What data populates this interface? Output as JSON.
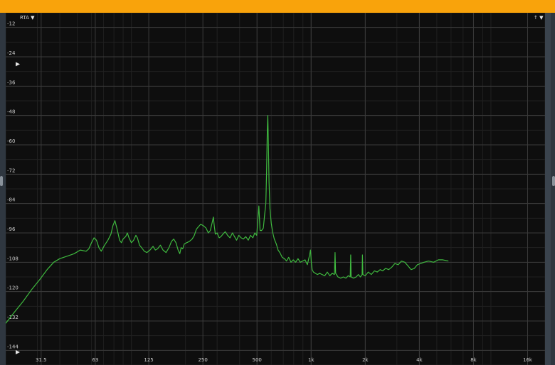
{
  "header": {
    "mode_label": "RTA",
    "dropdown_glyph": "▼",
    "right_label": "↑",
    "right_glyph": "▼"
  },
  "colors": {
    "titlebar": "#f9a30b",
    "background": "#0e0e0e",
    "grid_major": "#3a3a3a",
    "grid_minor": "#202020",
    "trace": "#3fb93f",
    "tick_text": "#cfcfcf"
  },
  "chart_data": {
    "type": "line",
    "title": "",
    "xlabel": "",
    "ylabel": "",
    "x_scale": "log",
    "xlim": [
      20,
      20000
    ],
    "ylim": [
      -150,
      -6
    ],
    "grid": true,
    "x_ticks": [
      {
        "value": 31.5,
        "label": "31.5"
      },
      {
        "value": 63,
        "label": "63"
      },
      {
        "value": 125,
        "label": "125"
      },
      {
        "value": 250,
        "label": "250"
      },
      {
        "value": 500,
        "label": "500"
      },
      {
        "value": 1000,
        "label": "1k"
      },
      {
        "value": 2000,
        "label": "2k"
      },
      {
        "value": 4000,
        "label": "4k"
      },
      {
        "value": 8000,
        "label": "8k"
      },
      {
        "value": 16000,
        "label": "16k"
      }
    ],
    "y_ticks": [
      {
        "value": -12,
        "label": "-12"
      },
      {
        "value": -24,
        "label": "-24"
      },
      {
        "value": -36,
        "label": "-36"
      },
      {
        "value": -48,
        "label": "-48"
      },
      {
        "value": -60,
        "label": "-60"
      },
      {
        "value": -72,
        "label": "-72"
      },
      {
        "value": -84,
        "label": "-84"
      },
      {
        "value": -96,
        "label": "-96"
      },
      {
        "value": -108,
        "label": "-108"
      },
      {
        "value": -120,
        "label": "-120"
      },
      {
        "value": -132,
        "label": "-132"
      },
      {
        "value": -144,
        "label": "-144"
      }
    ],
    "series": [
      {
        "points": [
          [
            20,
            -133
          ],
          [
            22,
            -129
          ],
          [
            25,
            -124
          ],
          [
            28,
            -119
          ],
          [
            31,
            -115
          ],
          [
            34,
            -111
          ],
          [
            37,
            -108
          ],
          [
            40,
            -106.5
          ],
          [
            44,
            -105.5
          ],
          [
            48,
            -104.5
          ],
          [
            52,
            -103
          ],
          [
            56,
            -103.5
          ],
          [
            58,
            -102.5
          ],
          [
            60,
            -100
          ],
          [
            62,
            -98
          ],
          [
            64,
            -99
          ],
          [
            66,
            -102
          ],
          [
            68,
            -103.5
          ],
          [
            71,
            -101
          ],
          [
            74,
            -99
          ],
          [
            77,
            -96.5
          ],
          [
            79,
            -93
          ],
          [
            81,
            -91
          ],
          [
            83,
            -94
          ],
          [
            86,
            -99
          ],
          [
            88,
            -100
          ],
          [
            90,
            -98.5
          ],
          [
            93,
            -97.5
          ],
          [
            95,
            -96
          ],
          [
            97,
            -98
          ],
          [
            100,
            -100
          ],
          [
            103,
            -99
          ],
          [
            106,
            -97
          ],
          [
            108,
            -98
          ],
          [
            111,
            -101
          ],
          [
            114,
            -102
          ],
          [
            118,
            -103.5
          ],
          [
            122,
            -104
          ],
          [
            127,
            -103
          ],
          [
            132,
            -101.5
          ],
          [
            136,
            -103
          ],
          [
            140,
            -102.5
          ],
          [
            145,
            -101
          ],
          [
            150,
            -103
          ],
          [
            156,
            -104
          ],
          [
            162,
            -102
          ],
          [
            167,
            -99.5
          ],
          [
            172,
            -98.5
          ],
          [
            177,
            -100
          ],
          [
            182,
            -103
          ],
          [
            186,
            -104.5
          ],
          [
            189,
            -102
          ],
          [
            193,
            -102.5
          ],
          [
            197,
            -100.5
          ],
          [
            203,
            -100
          ],
          [
            210,
            -99.5
          ],
          [
            218,
            -98.5
          ],
          [
            224,
            -97
          ],
          [
            230,
            -94.5
          ],
          [
            236,
            -93.5
          ],
          [
            243,
            -92.5
          ],
          [
            251,
            -93
          ],
          [
            260,
            -94
          ],
          [
            268,
            -96
          ],
          [
            275,
            -95
          ],
          [
            281,
            -92
          ],
          [
            286,
            -89.5
          ],
          [
            289,
            -93
          ],
          [
            293,
            -96.5
          ],
          [
            300,
            -96
          ],
          [
            308,
            -98
          ],
          [
            315,
            -97.5
          ],
          [
            323,
            -96.5
          ],
          [
            333,
            -95.5
          ],
          [
            343,
            -97
          ],
          [
            354,
            -98
          ],
          [
            365,
            -96
          ],
          [
            375,
            -97.5
          ],
          [
            385,
            -99
          ],
          [
            396,
            -97
          ],
          [
            408,
            -98
          ],
          [
            420,
            -98.5
          ],
          [
            433,
            -97.5
          ],
          [
            447,
            -99
          ],
          [
            460,
            -97
          ],
          [
            474,
            -98
          ],
          [
            486,
            -96
          ],
          [
            498,
            -97
          ],
          [
            512,
            -85
          ],
          [
            520,
            -95
          ],
          [
            530,
            -95
          ],
          [
            542,
            -94
          ],
          [
            552,
            -88
          ],
          [
            560,
            -84
          ],
          [
            565,
            -72
          ],
          [
            570,
            -55
          ],
          [
            574,
            -48
          ],
          [
            578,
            -58
          ],
          [
            583,
            -75
          ],
          [
            590,
            -86
          ],
          [
            600,
            -92
          ],
          [
            612,
            -96
          ],
          [
            624,
            -98.5
          ],
          [
            640,
            -100.5
          ],
          [
            655,
            -103
          ],
          [
            670,
            -104
          ],
          [
            690,
            -106
          ],
          [
            710,
            -106.5
          ],
          [
            730,
            -107.5
          ],
          [
            750,
            -106
          ],
          [
            772,
            -108
          ],
          [
            795,
            -107
          ],
          [
            820,
            -108
          ],
          [
            845,
            -106.5
          ],
          [
            870,
            -108
          ],
          [
            897,
            -107.5
          ],
          [
            925,
            -107
          ],
          [
            953,
            -109
          ],
          [
            980,
            -105
          ],
          [
            992,
            -103
          ],
          [
            1002,
            -108
          ],
          [
            1013,
            -111
          ],
          [
            1030,
            -112
          ],
          [
            1055,
            -112.5
          ],
          [
            1085,
            -113
          ],
          [
            1115,
            -112.5
          ],
          [
            1150,
            -113
          ],
          [
            1190,
            -113.5
          ],
          [
            1230,
            -112
          ],
          [
            1270,
            -113.5
          ],
          [
            1310,
            -112.5
          ],
          [
            1348,
            -113
          ],
          [
            1358,
            -104
          ],
          [
            1368,
            -112.5
          ],
          [
            1410,
            -114
          ],
          [
            1460,
            -114.5
          ],
          [
            1510,
            -114
          ],
          [
            1560,
            -114.5
          ],
          [
            1610,
            -113.5
          ],
          [
            1650,
            -114
          ],
          [
            1660,
            -105
          ],
          [
            1670,
            -114
          ],
          [
            1720,
            -114.5
          ],
          [
            1780,
            -114
          ],
          [
            1830,
            -113
          ],
          [
            1880,
            -114
          ],
          [
            1920,
            -113
          ],
          [
            1930,
            -105
          ],
          [
            1940,
            -113
          ],
          [
            2000,
            -113.5
          ],
          [
            2080,
            -112
          ],
          [
            2160,
            -113
          ],
          [
            2250,
            -111.5
          ],
          [
            2330,
            -112
          ],
          [
            2420,
            -111
          ],
          [
            2500,
            -111.5
          ],
          [
            2600,
            -110.5
          ],
          [
            2700,
            -111
          ],
          [
            2810,
            -110
          ],
          [
            2920,
            -108.5
          ],
          [
            3050,
            -109
          ],
          [
            3180,
            -107.5
          ],
          [
            3320,
            -108
          ],
          [
            3460,
            -109.5
          ],
          [
            3600,
            -111
          ],
          [
            3750,
            -110.5
          ],
          [
            3900,
            -109
          ],
          [
            4060,
            -108.5
          ],
          [
            4250,
            -108
          ],
          [
            4500,
            -107.5
          ],
          [
            4800,
            -108
          ],
          [
            5100,
            -107
          ],
          [
            5400,
            -107
          ],
          [
            5800,
            -107.5
          ]
        ]
      }
    ]
  }
}
